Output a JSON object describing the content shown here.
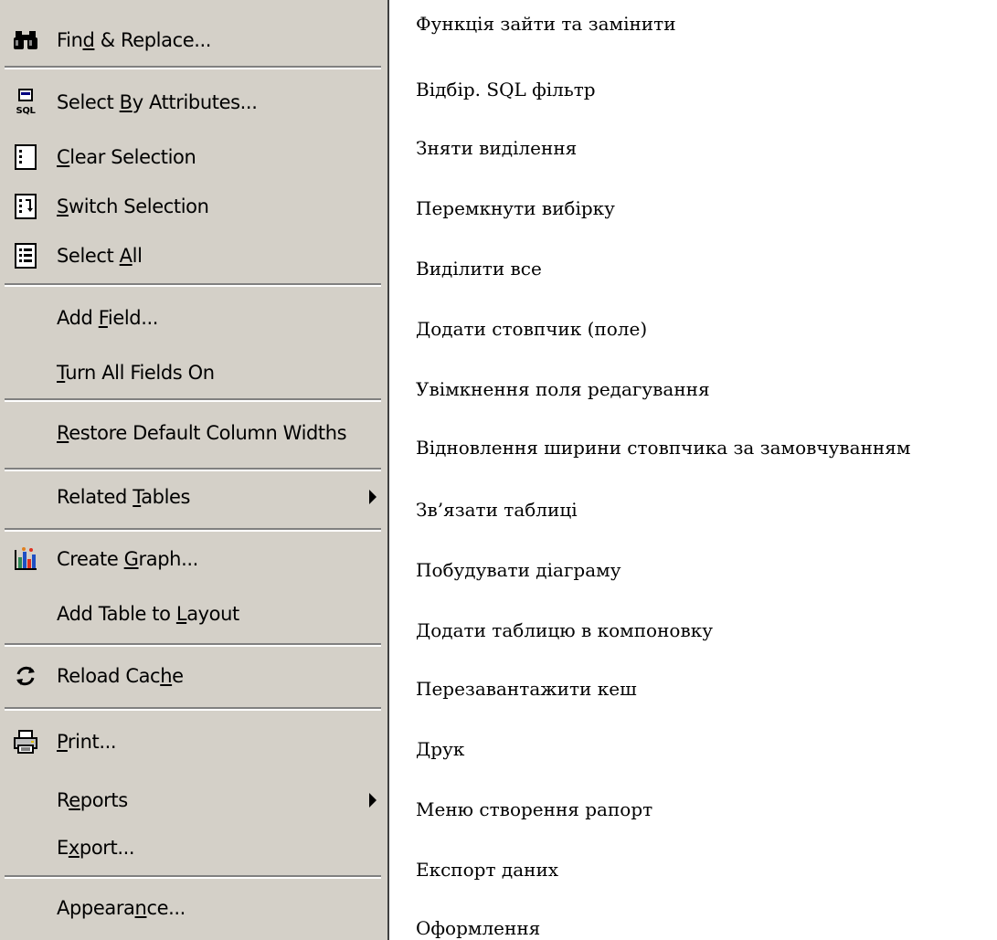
{
  "menu": {
    "items": [
      {
        "pre": "Fin",
        "u": "d",
        "post": " & Replace...",
        "icon": "binoculars-icon",
        "arrow": false
      },
      {
        "pre": "Select ",
        "u": "B",
        "post": "y Attributes...",
        "icon": "sql-icon",
        "arrow": false
      },
      {
        "pre": "",
        "u": "C",
        "post": "lear Selection",
        "icon": "clear-selection-icon",
        "arrow": false
      },
      {
        "pre": "",
        "u": "S",
        "post": "witch Selection",
        "icon": "switch-selection-icon",
        "arrow": false
      },
      {
        "pre": "Select ",
        "u": "A",
        "post": "ll",
        "icon": "select-all-icon",
        "arrow": false
      },
      {
        "pre": "Add ",
        "u": "F",
        "post": "ield...",
        "icon": "",
        "arrow": false
      },
      {
        "pre": "",
        "u": "T",
        "post": "urn All Fields On",
        "icon": "",
        "arrow": false
      },
      {
        "pre": "",
        "u": "R",
        "post": "estore Default Column Widths",
        "icon": "",
        "arrow": false
      },
      {
        "pre": "Related ",
        "u": "T",
        "post": "ables",
        "icon": "",
        "arrow": true
      },
      {
        "pre": "Create ",
        "u": "G",
        "post": "raph...",
        "icon": "graph-icon",
        "arrow": false
      },
      {
        "pre": "Add Table to ",
        "u": "L",
        "post": "ayout",
        "icon": "",
        "arrow": false
      },
      {
        "pre": "Reload Cac",
        "u": "h",
        "post": "e",
        "icon": "reload-icon",
        "arrow": false
      },
      {
        "pre": "",
        "u": "P",
        "post": "rint...",
        "icon": "printer-icon",
        "arrow": false
      },
      {
        "pre": "R",
        "u": "e",
        "post": "ports",
        "icon": "",
        "arrow": true
      },
      {
        "pre": "E",
        "u": "x",
        "post": "port...",
        "icon": "",
        "arrow": false
      },
      {
        "pre": "Appeara",
        "u": "n",
        "post": "ce...",
        "icon": "",
        "arrow": false
      }
    ]
  },
  "descriptions": [
    "Функція зайти та замінити",
    "Відбір. SQL фільтр",
    "Зняти виділення",
    "Перемкнути вибірку",
    "Виділити все",
    "Додати стовпчик (поле)",
    "Увімкнення поля редагування",
    "Відновлення ширини стовпчика за замовчуванням",
    "Зв’язати таблиці",
    "Побудувати діаграму",
    "Додати таблицю в компоновку",
    "Перезавантажити кеш",
    "Друк",
    "Меню створення рапорт",
    "Експорт даних",
    "Оформлення"
  ],
  "sql_icon_text": "SQL",
  "colors": {
    "menu_bg": "#d4d0c8",
    "separator_dark": "#808080",
    "separator_light": "#ffffff"
  }
}
